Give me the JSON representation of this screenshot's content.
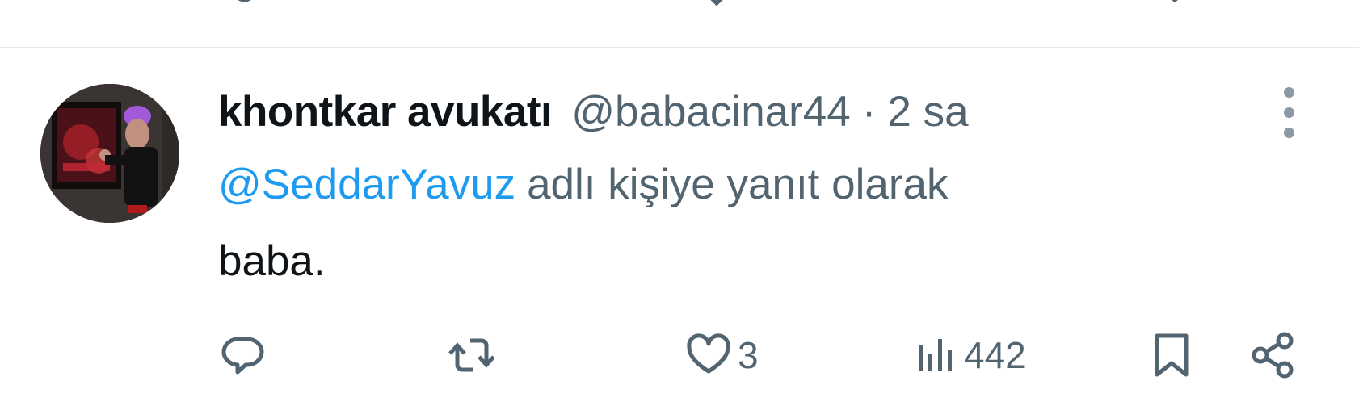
{
  "tweet": {
    "display_name": "khontkar avukatı",
    "handle": "@babacinar44",
    "separator": "·",
    "time": "2 sa",
    "reply_to": {
      "mention": "@SeddarYavuz",
      "suffix": "adlı kişiye yanıt olarak"
    },
    "text": "baba.",
    "actions": {
      "reply": {
        "icon": "reply-icon",
        "count": ""
      },
      "retweet": {
        "icon": "retweet-icon",
        "count": ""
      },
      "like": {
        "icon": "heart-icon",
        "count": "3"
      },
      "views": {
        "icon": "views-icon",
        "count": "442"
      },
      "bookmark": {
        "icon": "bookmark-icon"
      },
      "share": {
        "icon": "share-icon"
      }
    }
  },
  "colors": {
    "text_primary": "#0f1419",
    "text_secondary": "#536471",
    "link": "#1d9bf0",
    "divider": "#e6e9eb"
  }
}
